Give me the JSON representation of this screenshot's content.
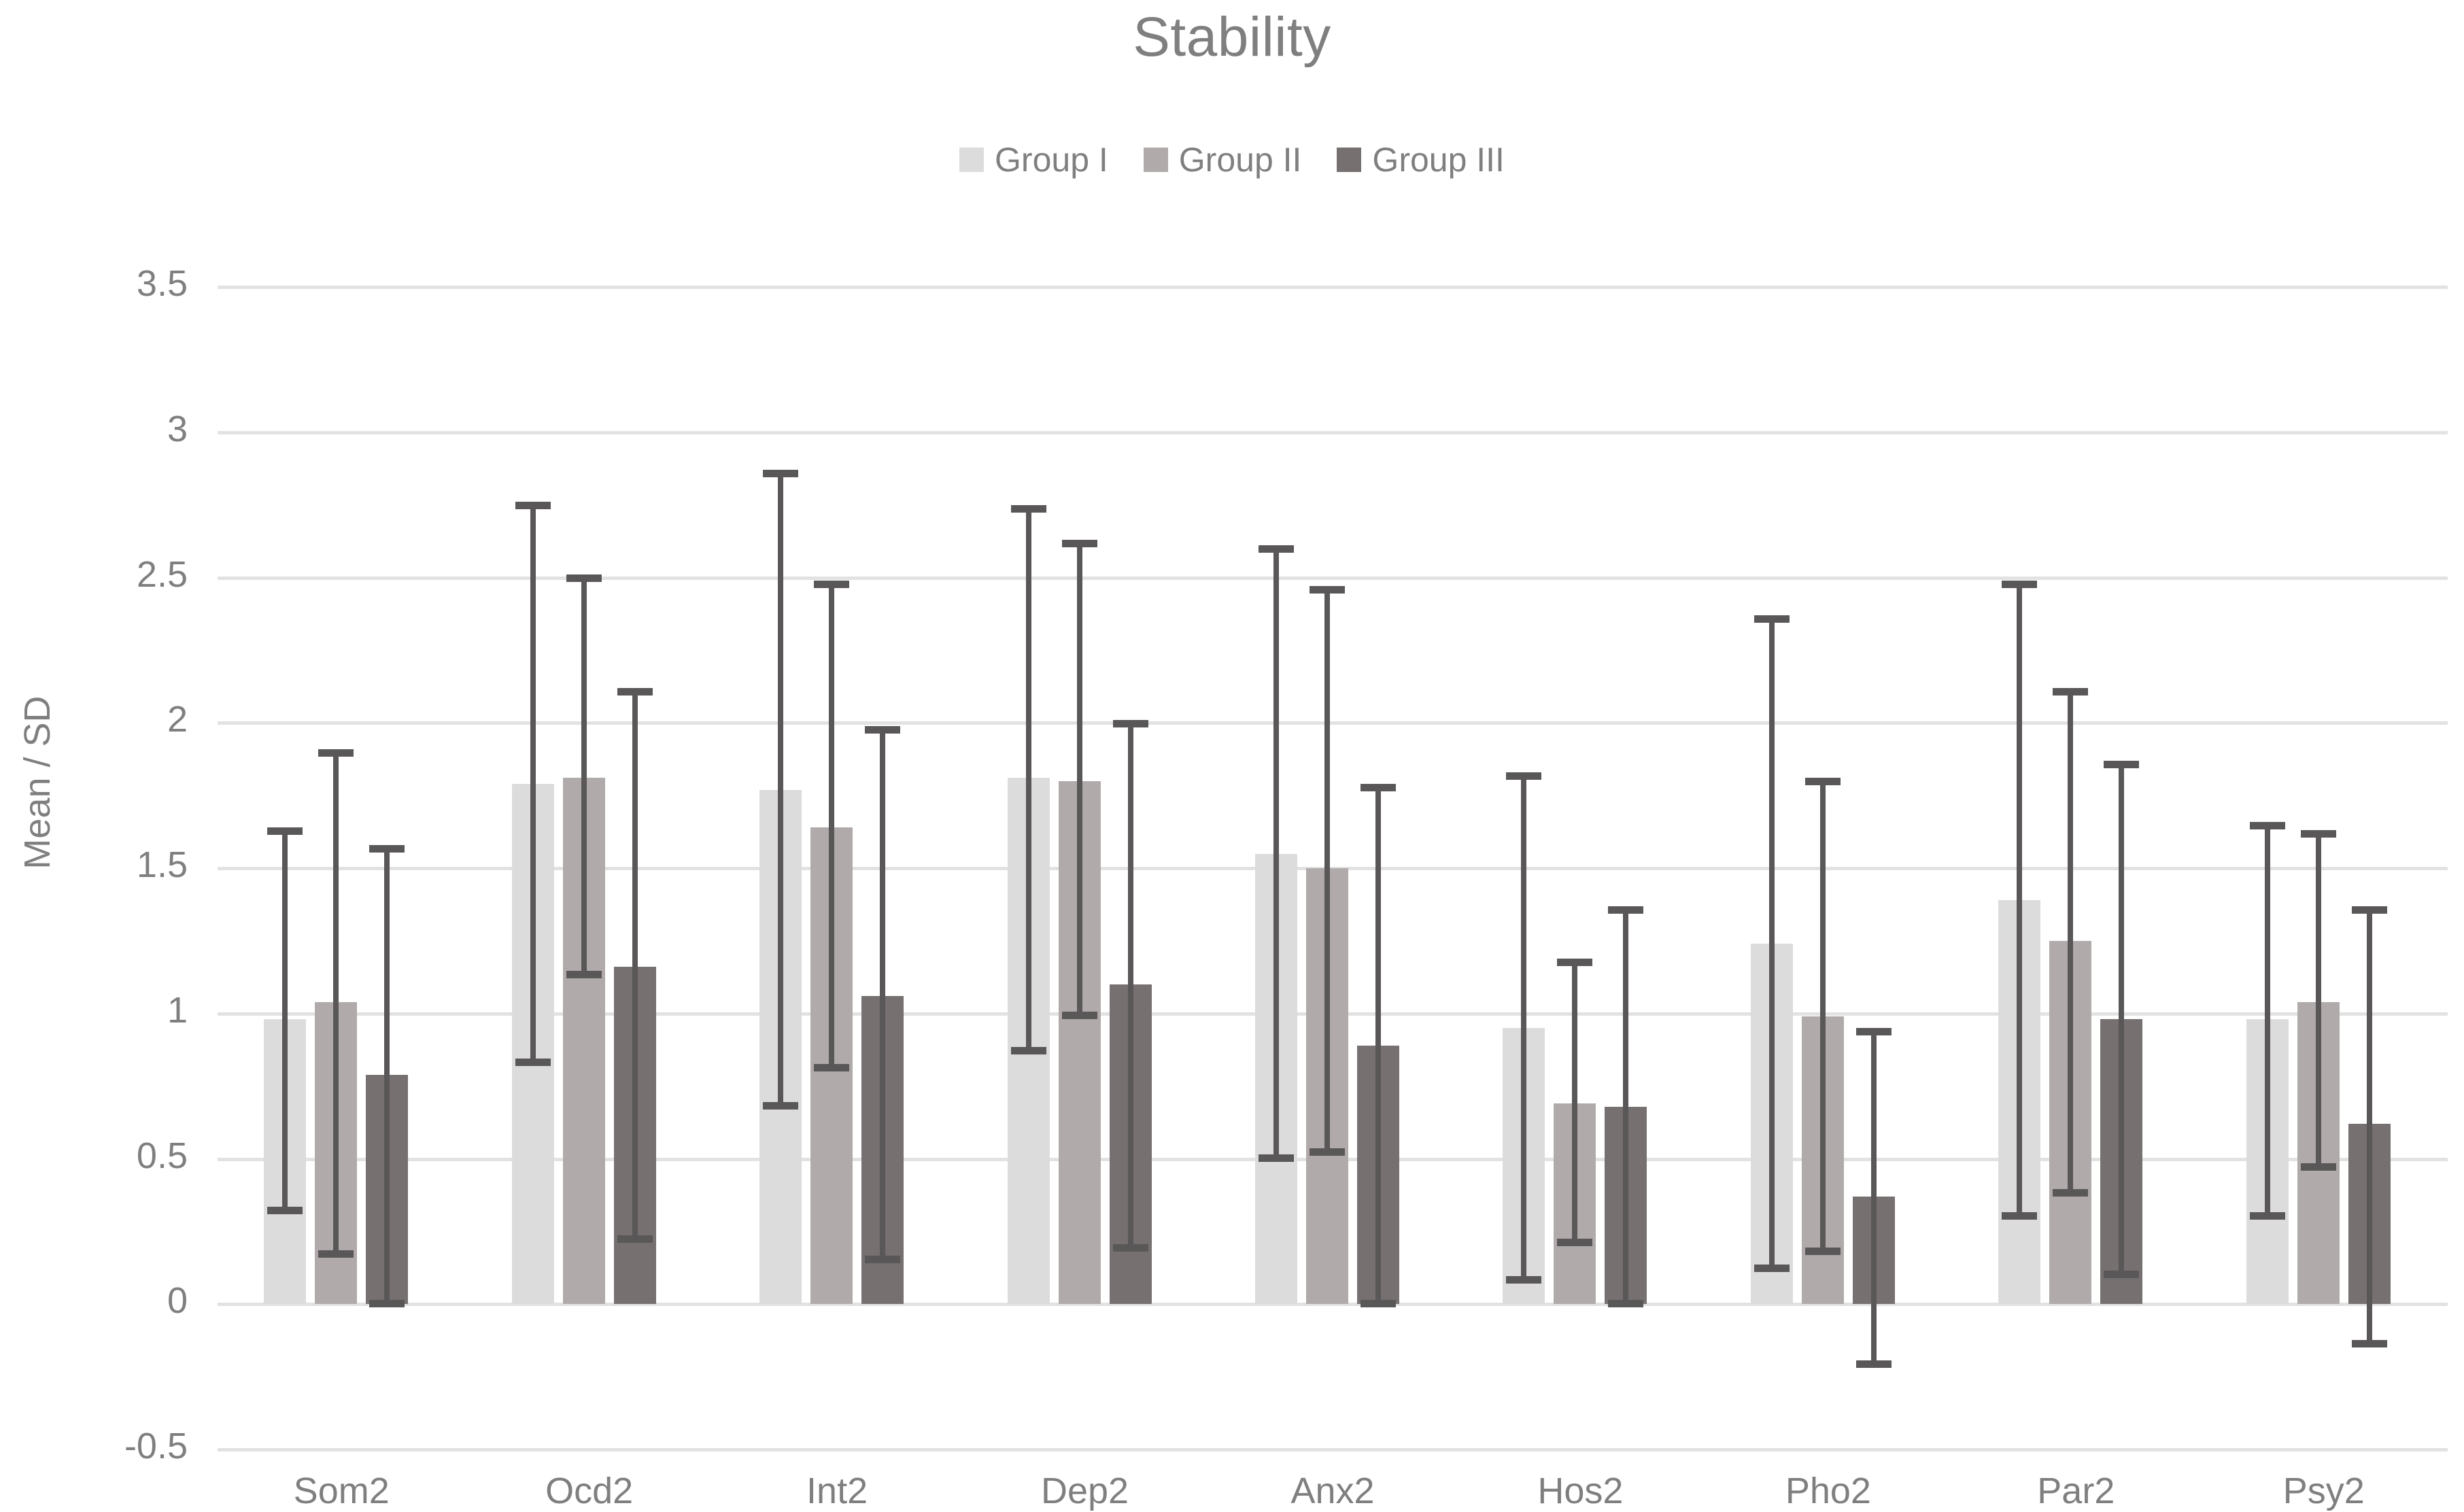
{
  "chart_data": {
    "type": "bar",
    "title": "Stability",
    "xlabel": "",
    "ylabel": "Mean / SD",
    "ylim": [
      -0.5,
      3.5
    ],
    "yticks": [
      "3.5",
      "3",
      "2.5",
      "2",
      "1.5",
      "1",
      "0.5",
      "0",
      "-0.5"
    ],
    "ytick_values": [
      3.5,
      3,
      2.5,
      2,
      1.5,
      1,
      0.5,
      0,
      -0.5
    ],
    "grid": true,
    "legend_position": "top",
    "categories": [
      "Som2",
      "Ocd2",
      "Int2",
      "Dep2",
      "Anx2",
      "Hos2",
      "Pho2",
      "Par2",
      "Psy2"
    ],
    "series": [
      {
        "name": "Group I",
        "color": "#dcdcdc",
        "values": [
          0.98,
          1.79,
          1.77,
          1.81,
          1.55,
          0.95,
          1.24,
          1.39,
          0.98
        ],
        "err_upper": [
          1.64,
          2.76,
          2.87,
          2.75,
          2.61,
          1.83,
          2.37,
          2.49,
          1.66
        ],
        "err_lower": [
          0.31,
          0.82,
          0.67,
          0.86,
          0.49,
          0.07,
          0.11,
          0.29,
          0.29
        ]
      },
      {
        "name": "Group II",
        "color": "#b0abaa",
        "values": [
          1.04,
          1.81,
          1.64,
          1.8,
          1.5,
          0.69,
          0.99,
          1.25,
          1.04
        ],
        "err_upper": [
          1.91,
          2.51,
          2.49,
          2.63,
          2.47,
          1.19,
          1.81,
          2.12,
          1.63
        ],
        "err_lower": [
          0.16,
          1.12,
          0.8,
          0.98,
          0.51,
          0.2,
          0.17,
          0.37,
          0.46
        ]
      },
      {
        "name": "Group III",
        "color": "#767070",
        "values": [
          0.79,
          1.16,
          1.06,
          1.1,
          0.89,
          0.68,
          0.37,
          0.98,
          0.62
        ],
        "err_upper": [
          1.58,
          2.12,
          1.99,
          2.01,
          1.79,
          1.37,
          0.95,
          1.87,
          1.37
        ],
        "err_lower": [
          -0.01,
          0.21,
          0.14,
          0.18,
          -0.01,
          -0.01,
          -0.22,
          0.09,
          -0.15
        ]
      }
    ]
  }
}
